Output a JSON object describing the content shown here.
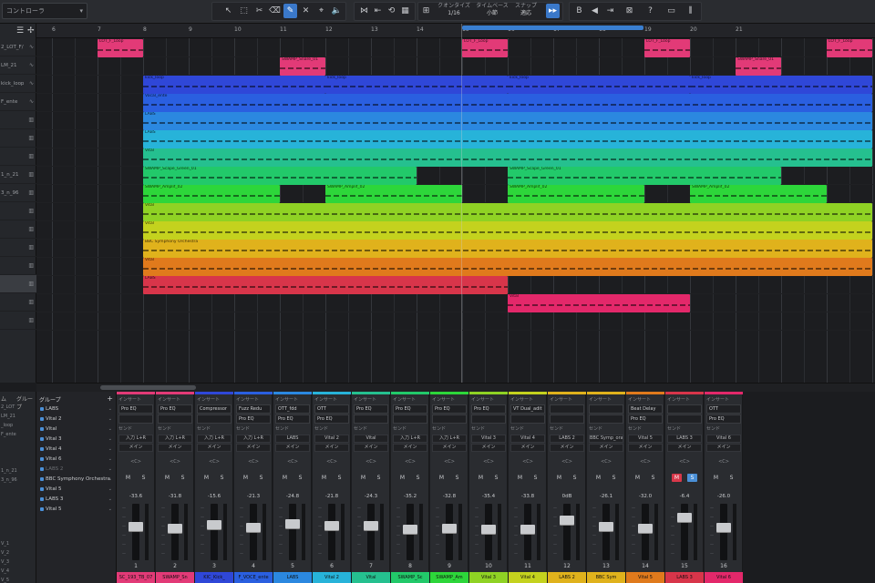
{
  "toolbar": {
    "controller_placeholder": "コントローラ",
    "quantize_label": "クオンタイズ",
    "quantize_value": "1/16",
    "timebase_label": "タイムベース",
    "timebase_value": "小節",
    "snap_label": "スナップ",
    "snap_value": "適応"
  },
  "ruler": {
    "bars": [
      "6",
      "7",
      "8",
      "9",
      "10",
      "11",
      "12",
      "13",
      "14",
      "15",
      "16",
      "17",
      "18",
      "19",
      "20",
      "21"
    ]
  },
  "tracks": [
    {
      "name": "2_LOT_F/",
      "icon": "wave"
    },
    {
      "name": "LM_21",
      "icon": "wave"
    },
    {
      "name": "kick_loop",
      "icon": "wave"
    },
    {
      "name": "F_ente",
      "icon": "wave"
    },
    {
      "name": "",
      "icon": "keys"
    },
    {
      "name": "",
      "icon": "keys"
    },
    {
      "name": "",
      "icon": "keys"
    },
    {
      "name": "1_n_21",
      "icon": "keys"
    },
    {
      "name": "3_n_96",
      "icon": "keys"
    },
    {
      "name": "",
      "icon": "keys"
    },
    {
      "name": "",
      "icon": "keys"
    },
    {
      "name": "",
      "icon": "keys"
    },
    {
      "name": "",
      "icon": "keys"
    },
    {
      "name": "",
      "icon": "keys"
    },
    {
      "name": "",
      "icon": "keys"
    },
    {
      "name": "",
      "icon": "keys"
    }
  ],
  "clips": [
    {
      "lane": 0,
      "start": 6,
      "len": 1,
      "color": "#e23a77",
      "label": "LOT_F_Loop"
    },
    {
      "lane": 0,
      "start": 14,
      "len": 1,
      "color": "#e23a77",
      "label": "LOT_F_Loop"
    },
    {
      "lane": 0,
      "start": 18,
      "len": 1,
      "color": "#e23a77",
      "label": "LOT_F_Loop"
    },
    {
      "lane": 0,
      "start": 22,
      "len": 1,
      "color": "#e23a77",
      "label": "LOT_F_Loop"
    },
    {
      "lane": 1,
      "start": 10,
      "len": 1,
      "color": "#e23a77",
      "label": "SWAMP_Snare_01"
    },
    {
      "lane": 1,
      "start": 20,
      "len": 1,
      "color": "#e23a77",
      "label": "SWAMP_Snare_01"
    },
    {
      "lane": 2,
      "start": 7,
      "len": 4,
      "color": "#2f47d8",
      "label": "kick_loop"
    },
    {
      "lane": 2,
      "start": 11,
      "len": 4,
      "color": "#2f47d8",
      "label": "kick_loop"
    },
    {
      "lane": 2,
      "start": 15,
      "len": 4,
      "color": "#2f47d8",
      "label": "kick_loop"
    },
    {
      "lane": 2,
      "start": 19,
      "len": 4,
      "color": "#2f47d8",
      "label": "kick_loop"
    },
    {
      "lane": 3,
      "start": 7,
      "len": 16,
      "color": "#2a5fe0",
      "label": "Vocal_ente"
    },
    {
      "lane": 4,
      "start": 7,
      "len": 16,
      "color": "#2b88e0",
      "label": "LABS"
    },
    {
      "lane": 5,
      "start": 7,
      "len": 16,
      "color": "#27b3d9",
      "label": "LABS"
    },
    {
      "lane": 6,
      "start": 7,
      "len": 16,
      "color": "#25c08f",
      "label": "Vital"
    },
    {
      "lane": 7,
      "start": 7,
      "len": 6,
      "color": "#22c96a",
      "label": "SWAMP_Scape_Green_01"
    },
    {
      "lane": 7,
      "start": 15,
      "len": 6,
      "color": "#22c96a",
      "label": "SWAMP_Scape_Green_01"
    },
    {
      "lane": 8,
      "start": 7,
      "len": 3,
      "color": "#2dd63a",
      "label": "SWAMP_Amplif_02"
    },
    {
      "lane": 8,
      "start": 11,
      "len": 3,
      "color": "#2dd63a",
      "label": "SWAMP_Amplif_02"
    },
    {
      "lane": 8,
      "start": 15,
      "len": 3,
      "color": "#2dd63a",
      "label": "SWAMP_Amplif_02"
    },
    {
      "lane": 8,
      "start": 19,
      "len": 3,
      "color": "#2dd63a",
      "label": "SWAMP_Amplif_02"
    },
    {
      "lane": 9,
      "start": 7,
      "len": 16,
      "color": "#8fd224",
      "label": "Vital"
    },
    {
      "lane": 10,
      "start": 7,
      "len": 16,
      "color": "#c4d21e",
      "label": "Vital"
    },
    {
      "lane": 11,
      "start": 7,
      "len": 16,
      "color": "#e0b21c",
      "label": "BBC Symphony Orchestra"
    },
    {
      "lane": 12,
      "start": 7,
      "len": 16,
      "color": "#e07a1c",
      "label": "Vital"
    },
    {
      "lane": 13,
      "start": 7,
      "len": 8,
      "color": "#d8354a",
      "label": "LABS"
    },
    {
      "lane": 14,
      "start": 15,
      "len": 4,
      "color": "#e3286a",
      "label": "Vital"
    }
  ],
  "mixer": {
    "left_header": "ム",
    "group_header": "グループ",
    "left_labels": [
      "2_LOT",
      "LM_21",
      "_loop",
      "F_ente",
      "",
      "",
      "",
      "1_n_21",
      "3_n_96",
      "",
      "",
      "",
      "",
      "",
      "",
      "V_1",
      "V_2",
      "V_3",
      "V_4",
      "V_5"
    ],
    "group_label": "グループ",
    "groups": [
      {
        "name": "LABS",
        "visible": "👁",
        "dim": false
      },
      {
        "name": "Vital 2",
        "visible": "👁",
        "dim": false
      },
      {
        "name": "Vital",
        "visible": "👁",
        "dim": false
      },
      {
        "name": "Vital 3",
        "visible": "👁",
        "dim": false
      },
      {
        "name": "Vital 4",
        "visible": "👁",
        "dim": false
      },
      {
        "name": "Vital 6",
        "visible": "👁",
        "dim": false
      },
      {
        "name": "LABS 2",
        "visible": "👁",
        "dim": true
      },
      {
        "name": "BBC Symphony Orchestra",
        "visible": "👁",
        "dim": false
      },
      {
        "name": "Vital 5",
        "visible": "👁",
        "dim": false
      },
      {
        "name": "LABS 3",
        "visible": "👁",
        "dim": false
      },
      {
        "name": "Vital 5",
        "visible": "👁",
        "dim": false
      }
    ],
    "insert_label": "インサート",
    "send_label": "センド",
    "main_label": "メイン",
    "center_label": "<C>",
    "m_label": "M",
    "s_label": "S",
    "strips": [
      {
        "color": "#e23a77",
        "insert1": "Pro EQ",
        "insert2": "",
        "io": "入力 L+R",
        "vol": "-33.6",
        "num": "1",
        "name": "SC_193_TB_07",
        "nameColor": "#e23a77",
        "mute": false,
        "solo": false,
        "fader": 0.62
      },
      {
        "color": "#e23a77",
        "insert1": "Pro EQ",
        "insert2": "",
        "io": "入力 L+R",
        "vol": "-31.8",
        "num": "2",
        "name": "SWAMP_Sn",
        "nameColor": "#e23a77",
        "mute": false,
        "solo": false,
        "fader": 0.58
      },
      {
        "color": "#2f47d8",
        "insert1": "Compressor",
        "insert2": "",
        "io": "入力 L+R",
        "vol": "-15.6",
        "num": "3",
        "name": "KIC_Kick_",
        "nameColor": "#2f47d8",
        "mute": false,
        "solo": false,
        "fader": 0.66
      },
      {
        "color": "#2a5fe0",
        "insert1": "Fuzz Redu",
        "insert2": "Pro EQ",
        "io": "入力 L+R",
        "vol": "-21.3",
        "num": "4",
        "name": "F_VOCE_ente",
        "nameColor": "#2a5fe0",
        "mute": false,
        "solo": false,
        "fader": 0.6
      },
      {
        "color": "#2b88e0",
        "insert1": "OTT_fdd",
        "insert2": "Pro EQ",
        "io": "LABS",
        "vol": "-24.8",
        "num": "5",
        "name": "LABS",
        "nameColor": "#2b88e0",
        "mute": false,
        "solo": false,
        "fader": 0.68
      },
      {
        "color": "#27b3d9",
        "insert1": "OTT",
        "insert2": "Pro EQ",
        "io": "Vital 2",
        "vol": "-21.8",
        "num": "6",
        "name": "Vital 2",
        "nameColor": "#27b3d9",
        "mute": false,
        "solo": false,
        "fader": 0.64
      },
      {
        "color": "#25c08f",
        "insert1": "Pro EQ",
        "insert2": "",
        "io": "Vital",
        "vol": "-24.3",
        "num": "7",
        "name": "Vital",
        "nameColor": "#25c08f",
        "mute": false,
        "solo": false,
        "fader": 0.63
      },
      {
        "color": "#22c96a",
        "insert1": "Pro EQ",
        "insert2": "",
        "io": "入力 L+R",
        "vol": "-35.2",
        "num": "8",
        "name": "SWAMP_Sc",
        "nameColor": "#22c96a",
        "mute": false,
        "solo": false,
        "fader": 0.55
      },
      {
        "color": "#2dd63a",
        "insert1": "Pro EQ",
        "insert2": "",
        "io": "入力 L+R",
        "vol": "-32.8",
        "num": "9",
        "name": "SWAMP_Am",
        "nameColor": "#2dd63a",
        "mute": false,
        "solo": false,
        "fader": 0.57
      },
      {
        "color": "#8fd224",
        "insert1": "Pro EQ",
        "insert2": "",
        "io": "Vital 3",
        "vol": "-35.4",
        "num": "10",
        "name": "Vital 3",
        "nameColor": "#8fd224",
        "mute": false,
        "solo": false,
        "fader": 0.56
      },
      {
        "color": "#c4d21e",
        "insert1": "VT Dual_adit",
        "insert2": "",
        "io": "Vital 4",
        "vol": "-33.8",
        "num": "11",
        "name": "Vital 4",
        "nameColor": "#c4d21e",
        "mute": false,
        "solo": false,
        "fader": 0.56
      },
      {
        "color": "#e0b21c",
        "insert1": "",
        "insert2": "",
        "io": "LABS 2",
        "vol": "0dB",
        "num": "12",
        "name": "LABS 2",
        "nameColor": "#e0b21c",
        "mute": false,
        "solo": false,
        "fader": 0.75
      },
      {
        "color": "#e0b21c",
        "insert1": "",
        "insert2": "",
        "io": "BBC Symp_ora",
        "vol": "-26.1",
        "num": "13",
        "name": "BBC Sym",
        "nameColor": "#e0b21c",
        "mute": false,
        "solo": false,
        "fader": 0.62
      },
      {
        "color": "#e07a1c",
        "insert1": "Beat Delay",
        "insert2": "Pro EQ",
        "io": "Vital 5",
        "vol": "-32.0",
        "num": "14",
        "name": "Vital 5",
        "nameColor": "#e07a1c",
        "mute": false,
        "solo": false,
        "fader": 0.58
      },
      {
        "color": "#d8354a",
        "insert1": "",
        "insert2": "",
        "io": "LABS 3",
        "vol": "-6.4",
        "num": "15",
        "name": "LABS 3",
        "nameColor": "#d8354a",
        "mute": true,
        "solo": true,
        "fader": 0.8
      },
      {
        "color": "#e3286a",
        "insert1": "OTT",
        "insert2": "Pro EQ",
        "io": "Vital 6",
        "vol": "-26.0",
        "num": "16",
        "name": "Vital 6",
        "nameColor": "#e3286a",
        "mute": false,
        "solo": false,
        "fader": 0.6
      }
    ]
  }
}
